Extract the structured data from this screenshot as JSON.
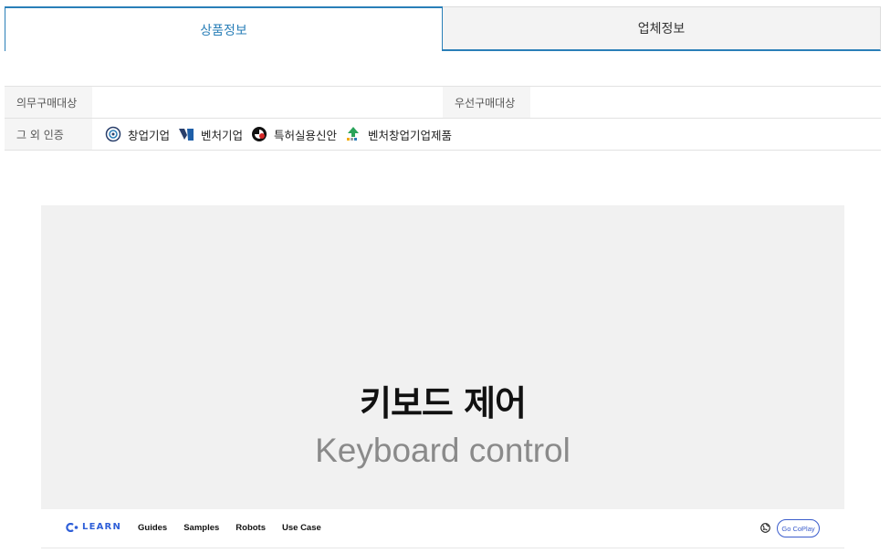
{
  "tabs": [
    {
      "label": "상품정보",
      "active": true
    },
    {
      "label": "업체정보",
      "active": false
    }
  ],
  "info": {
    "mandatory_label": "의무구매대상",
    "mandatory_value": "",
    "priority_label": "우선구매대상",
    "priority_value": "",
    "other_cert_label": "그 외 인증",
    "certs": [
      {
        "label": "창업기업",
        "icon": "startup-cert-icon"
      },
      {
        "label": "벤처기업",
        "icon": "venture-cert-icon"
      },
      {
        "label": "특허실용신안",
        "icon": "patent-cert-icon"
      },
      {
        "label": "벤처창업기업제품",
        "icon": "venture-startup-product-icon"
      }
    ]
  },
  "hero": {
    "title": "키보드 제어",
    "subtitle": "Keyboard control"
  },
  "navbar": {
    "logo_text": "LEARN",
    "links": [
      "Guides",
      "Samples",
      "Robots",
      "Use Case"
    ],
    "cta": "Go CoPlay"
  },
  "colors": {
    "accent": "#2a7fb8",
    "brand_blue": "#2f5fd8",
    "hero_bg": "#f1f1f1"
  }
}
